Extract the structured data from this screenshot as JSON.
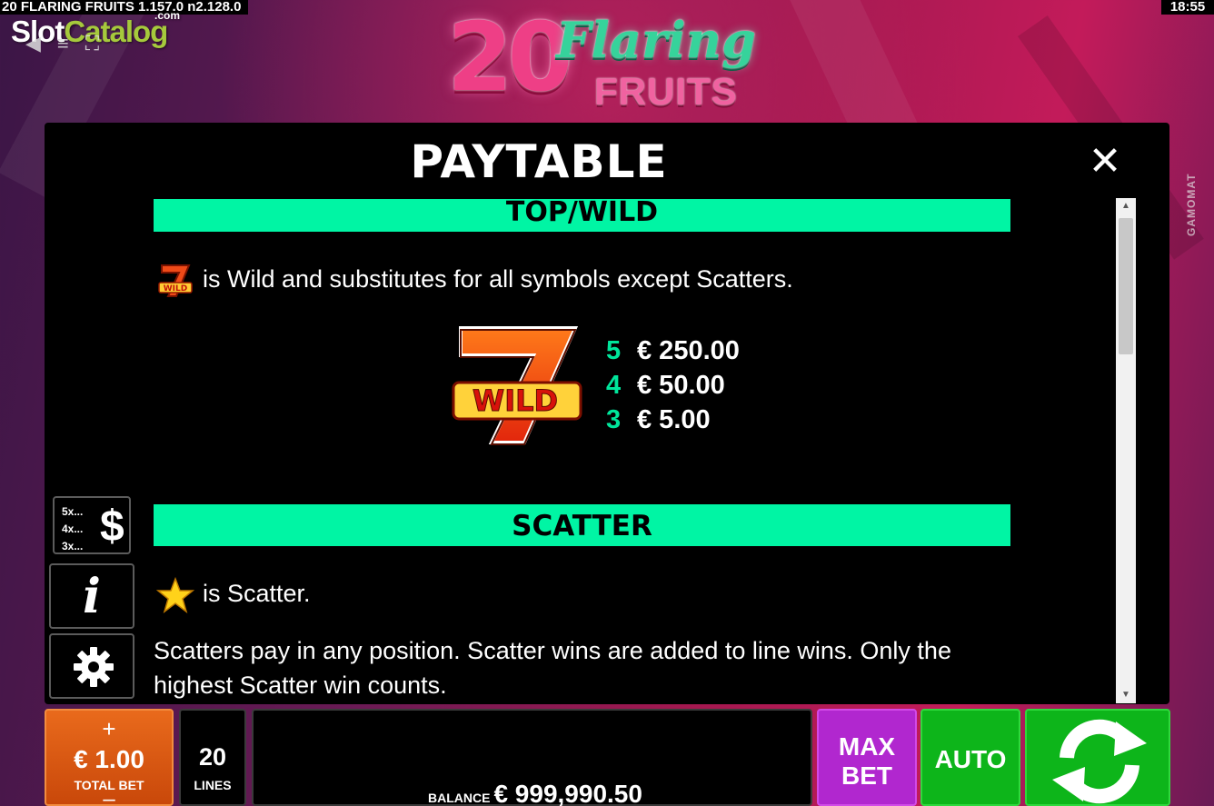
{
  "status_bar": {
    "title": "20 FLARING FRUITS  1.157.0 n2.128.0",
    "clock": "18:55"
  },
  "watermark": {
    "part1": "Slot",
    "part2": "Catalog",
    "suffix": ".com"
  },
  "logo": {
    "number": "20",
    "word1": "Flaring",
    "word2": "FRUITS"
  },
  "provider": "GAMOMAT",
  "paytable": {
    "title": "PAYTABLE",
    "close_icon": "close-icon",
    "sections": {
      "wild": {
        "header": "TOP/WILD",
        "description": "is Wild and substitutes for all symbols except Scatters.",
        "symbol_icon": "seven-wild-icon",
        "payouts": [
          {
            "count": "5",
            "value": "€ 250.00"
          },
          {
            "count": "4",
            "value": "€ 50.00"
          },
          {
            "count": "3",
            "value": "€ 5.00"
          }
        ]
      },
      "scatter": {
        "header": "SCATTER",
        "description": "is Scatter.",
        "symbol_icon": "star-icon",
        "rules": "Scatters pay in any position. Scatter wins are added to line wins. Only the highest Scatter win counts."
      }
    },
    "scroll_position": 0.0
  },
  "side_buttons": {
    "paytable": {
      "lines": [
        "5x...",
        "4x...",
        "3x..."
      ],
      "icon": "dollar-icon"
    },
    "info": {
      "icon": "info-icon"
    },
    "settings": {
      "icon": "gear-icon"
    }
  },
  "bottom_bar": {
    "bet": {
      "plus": "+",
      "value": "€ 1.00",
      "label": "TOTAL BET",
      "minus": "–"
    },
    "lines": {
      "value": "20",
      "label": "LINES"
    },
    "balance": {
      "label": "BALANCE",
      "value": "€ 999,990.50"
    },
    "max_bet": {
      "line1": "MAX",
      "line2": "BET"
    },
    "auto": {
      "label": "AUTO"
    },
    "spin": {
      "icon": "spin-arrows-icon"
    }
  },
  "colors": {
    "section_bar": "#00f5a4",
    "payout_count": "#00e59b",
    "total_bet": "#e96a1c",
    "max_bet": "#b127cf",
    "auto_spin": "#0db51a"
  }
}
